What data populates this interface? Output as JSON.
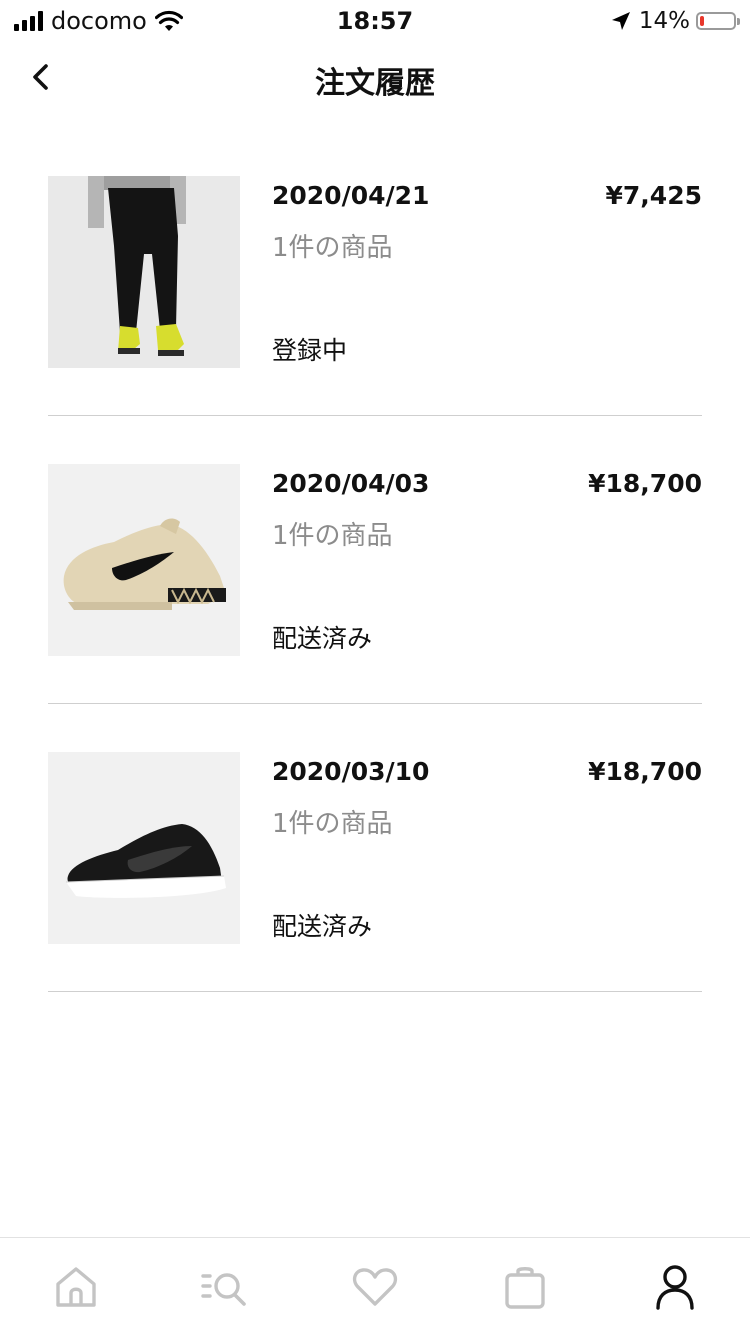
{
  "status_bar": {
    "carrier": "docomo",
    "time": "18:57",
    "battery": "14%",
    "battery_level": 0.14,
    "battery_color": "#e8372b"
  },
  "nav": {
    "title": "注文履歴",
    "back_icon": "chevron-left-icon"
  },
  "orders": [
    {
      "date": "2020/04/21",
      "price": "¥7,425",
      "count": "1件の商品",
      "status": "登録中",
      "product_icon": "black-sweatpants-image"
    },
    {
      "date": "2020/04/03",
      "price": "¥18,700",
      "count": "1件の商品",
      "status": "配送済み",
      "product_icon": "beige-sneaker-image"
    },
    {
      "date": "2020/03/10",
      "price": "¥18,700",
      "count": "1件の商品",
      "status": "配送済み",
      "product_icon": "black-sneaker-image"
    }
  ],
  "tabs": [
    {
      "icon": "home-icon",
      "active": false
    },
    {
      "icon": "search-list-icon",
      "active": false
    },
    {
      "icon": "heart-icon",
      "active": false
    },
    {
      "icon": "bag-icon",
      "active": false
    },
    {
      "icon": "profile-icon",
      "active": true
    }
  ],
  "colors": {
    "text": "#111111",
    "muted": "#8c8c8c",
    "divider": "#cfcfcf",
    "tab_inactive": "#c4c4c4",
    "tab_active": "#111111"
  }
}
